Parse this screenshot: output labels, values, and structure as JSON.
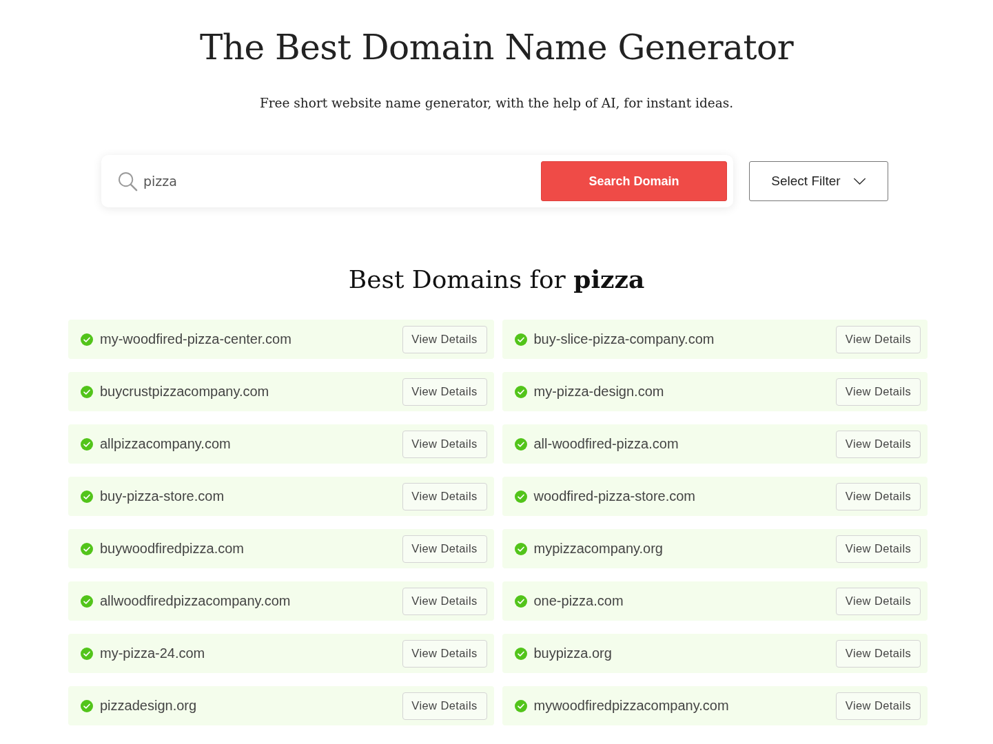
{
  "header": {
    "title": "The Best Domain Name Generator",
    "subtitle": "Free short website name generator, with the help of AI, for instant ideas."
  },
  "search": {
    "value": "pizza",
    "button": "Search Domain",
    "filter": "Select Filter"
  },
  "results": {
    "heading": "Best Domains for **pizza**",
    "items": [
      {
        "domain": "my-woodfired-pizza-center.com",
        "available": true,
        "action": "View Details"
      },
      {
        "domain": "buy-slice-pizza-company.com",
        "available": true,
        "action": "View Details"
      },
      {
        "domain": "buycrustpizzacompany.com",
        "available": true,
        "action": "View Details"
      },
      {
        "domain": "my-pizza-design.com",
        "available": true,
        "action": "View Details"
      },
      {
        "domain": "allpizzacompany.com",
        "available": true,
        "action": "View Details"
      },
      {
        "domain": "all-woodfired-pizza.com",
        "available": true,
        "action": "View Details"
      },
      {
        "domain": "buy-pizza-store.com",
        "available": true,
        "action": "View Details"
      },
      {
        "domain": "woodfired-pizza-store.com",
        "available": true,
        "action": "View Details"
      },
      {
        "domain": "buywoodfiredpizza.com",
        "available": true,
        "action": "View Details"
      },
      {
        "domain": "mypizzacompany.org",
        "available": true,
        "action": "View Details"
      },
      {
        "domain": "allwoodfiredpizzacompany.com",
        "available": true,
        "action": "View Details"
      },
      {
        "domain": "one-pizza.com",
        "available": true,
        "action": "View Details"
      },
      {
        "domain": "my-pizza-24.com",
        "available": true,
        "action": "View Details"
      },
      {
        "domain": "buypizza.org",
        "available": true,
        "action": "View Details"
      },
      {
        "domain": "pizzadesign.org",
        "available": true,
        "action": "View Details"
      },
      {
        "domain": "mywoodfiredpizzacompany.com",
        "available": true,
        "action": "View Details"
      }
    ]
  }
}
